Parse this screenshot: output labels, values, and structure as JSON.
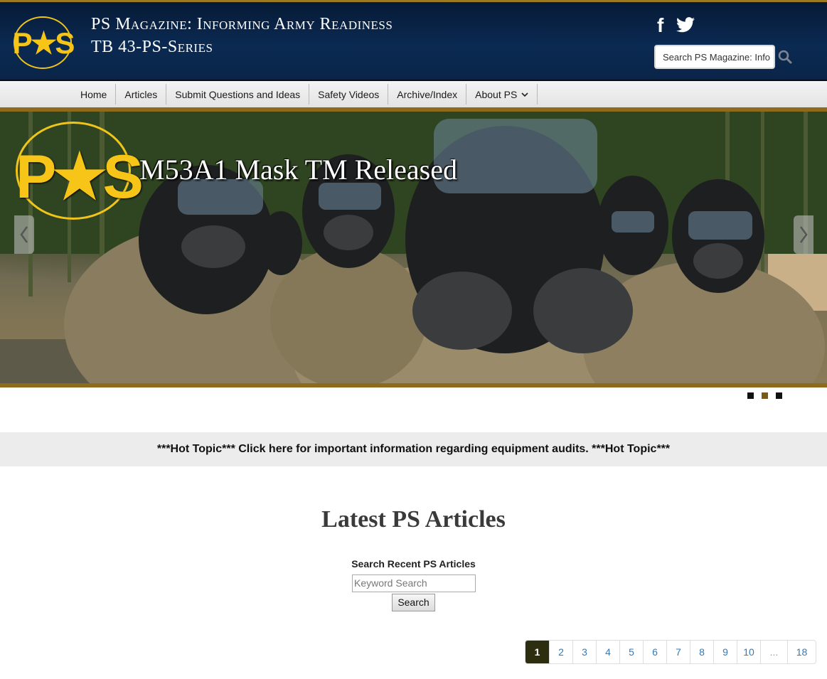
{
  "header": {
    "logo_text": "P★S",
    "title_line1": "PS Magazine: Informing Army Readiness",
    "title_line2": "TB 43-PS-Series",
    "search_placeholder": "Search PS Magazine: Info",
    "facebook_icon": "f"
  },
  "nav": {
    "items": [
      {
        "label": "Home"
      },
      {
        "label": "Articles"
      },
      {
        "label": "Submit Questions and Ideas"
      },
      {
        "label": "Safety Videos"
      },
      {
        "label": "Archive/Index"
      },
      {
        "label": "About PS"
      }
    ]
  },
  "hero": {
    "logo_text": "P★S",
    "caption": "M53A1 Mask TM Released"
  },
  "hot_topic": "***Hot Topic*** Click here for important information regarding equipment audits. ***Hot Topic***",
  "latest": {
    "title": "Latest PS Articles",
    "search_label": "Search Recent PS Articles",
    "keyword_placeholder": "Keyword Search",
    "search_button": "Search"
  },
  "pagination": {
    "pages": [
      "1",
      "2",
      "3",
      "4",
      "5",
      "6",
      "7",
      "8",
      "9",
      "10",
      "...",
      "18"
    ]
  },
  "colors": {
    "header_bg": "#0b2a52",
    "gold": "#f6c518",
    "border_gold": "#8d6a1c",
    "active_page": "#2d2d10"
  }
}
